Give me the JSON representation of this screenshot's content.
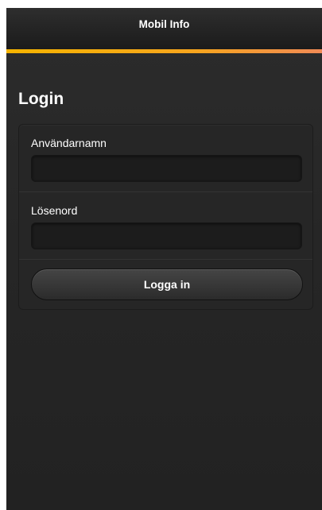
{
  "header": {
    "title": "Mobil Info"
  },
  "page": {
    "title": "Login"
  },
  "form": {
    "username_label": "Användarnamn",
    "username_value": "",
    "password_label": "Lösenord",
    "password_value": "",
    "submit_label": "Logga in"
  },
  "colors": {
    "accent_start": "#f5b400",
    "accent_end": "#f08a55",
    "background": "#262626"
  }
}
